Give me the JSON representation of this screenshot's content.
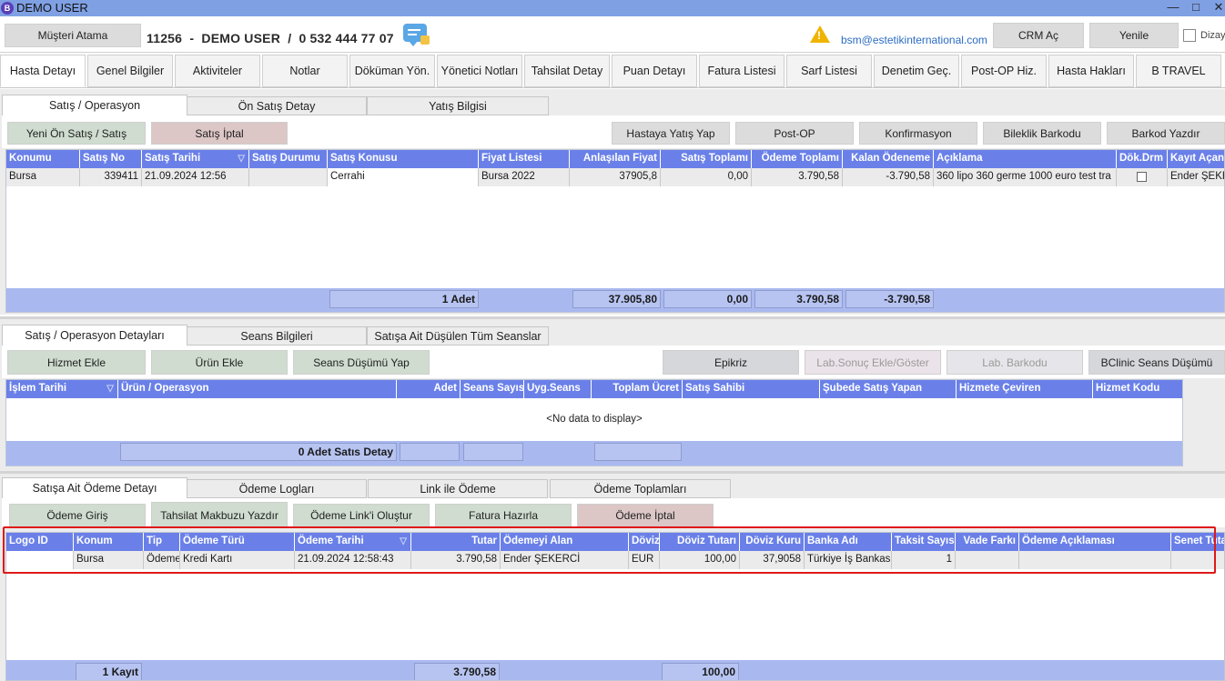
{
  "window": {
    "title": "DEMO USER",
    "app_icon": "B"
  },
  "topbar": {
    "assign_button": "Müşteri Atama",
    "patient_id": "11256",
    "sep1": "-",
    "patient_name": "DEMO USER",
    "sep2": "/",
    "patient_phone": "0 532 444 77 07",
    "email": "bsm@estetikinternational.com",
    "crm_button": "CRM Aç",
    "refresh_button": "Yenile",
    "edit_label": "Dizayn"
  },
  "main_tabs": [
    "Hasta Detayı",
    "Genel Bilgiler",
    "Aktiviteler",
    "Notlar",
    "Döküman Yön.",
    "Yönetici Notları",
    "Tahsilat Detay",
    "Puan Detayı",
    "Fatura Listesi",
    "Sarf Listesi",
    "Denetim Geç.",
    "Post-OP Hiz.",
    "Hasta Hakları",
    "B TRAVEL"
  ],
  "sales": {
    "tabs": [
      "Satış / Operasyon",
      "Ön Satış Detay",
      "Yatış Bilgisi"
    ],
    "buttons": {
      "pre_sale": "Yeni Ön Satış / Satış",
      "cancel": "Satış İptal",
      "admit": "Hastaya Yatış Yap",
      "post_op": "Post-OP",
      "confirm": "Konfirmasyon",
      "bracelet": "Bileklik Barkodu",
      "barcode": "Barkod Yazdır"
    },
    "columns": [
      "Konumu",
      "Satış No",
      "Satış Tarihi",
      "Satış Durumu",
      "Satış Konusu",
      "Fiyat Listesi",
      "Anlaşılan Fiyat",
      "Satış Toplamı",
      "Ödeme Toplamı",
      "Kalan Ödeneme",
      "Açıklama",
      "Dök.Drm",
      "Kayıt Açan"
    ],
    "rows": [
      [
        "Bursa",
        "339411",
        "21.09.2024 12:56",
        "",
        "Cerrahi",
        "Bursa 2022",
        "37905,8",
        "0,00",
        "3.790,58",
        "-3.790,58",
        "360 lipo 360 germe 1000 euro test tra",
        "",
        "Ender ŞEKERCİ"
      ]
    ],
    "footer": {
      "count": "1 Adet",
      "agreed": "37.905,80",
      "sales_total": "0,00",
      "paid": "3.790,58",
      "remaining": "-3.790,58"
    }
  },
  "details": {
    "tabs": [
      "Satış / Operasyon Detayları",
      "Seans Bilgileri",
      "Satışa Ait Düşülen Tüm Seanslar"
    ],
    "buttons": {
      "add_service": "Hizmet Ekle",
      "add_product": "Ürün Ekle",
      "session_deduct": "Seans Düşümü Yap",
      "epicrisis": "Epikriz",
      "lab_result": "Lab.Sonuç Ekle/Göster",
      "lab_barcode": "Lab. Barkodu",
      "bclinic": "BClinic Seans Düşümü"
    },
    "columns": [
      "İşlem Tarihi",
      "Ürün / Operasyon",
      "Adet",
      "Seans Sayısı",
      "Uyg.Seans",
      "Toplam Ücret",
      "Satış Sahibi",
      "Şubede Satış Yapan",
      "Hizmete Çeviren",
      "Hizmet Kodu"
    ],
    "empty_text": "<No data to display>",
    "footer": {
      "count": "0 Adet Satıs Detay"
    }
  },
  "payments": {
    "tabs": [
      "Satışa Ait Ödeme Detayı",
      "Ödeme Logları",
      "Link ile Ödeme",
      "Ödeme Toplamları"
    ],
    "buttons": {
      "entry": "Ödeme Giriş",
      "receipt": "Tahsilat Makbuzu Yazdır",
      "link": "Ödeme Link'i Oluştur",
      "invoice": "Fatura Hazırla",
      "cancel": "Ödeme İptal"
    },
    "columns": [
      "Logo ID",
      "Konum",
      "Tip",
      "Ödeme Türü",
      "Ödeme Tarihi",
      "Tutar",
      "Ödemeyi Alan",
      "Döviz",
      "Döviz Tutarı",
      "Döviz Kuru",
      "Banka Adı",
      "Taksit Sayısı",
      "Vade Farkı",
      "Ödeme Açıklaması",
      "Senet Tutarı"
    ],
    "rows": [
      [
        "",
        "Bursa",
        "Ödeme",
        "Kredi Kartı",
        "21.09.2024 12:58:43",
        "3.790,58",
        "Ender ŞEKERCİ",
        "EUR",
        "100,00",
        "37,9058",
        "Türkiye İş Bankası",
        "1",
        "",
        "",
        ""
      ]
    ],
    "footer": {
      "count": "1 Kayıt",
      "amount": "3.790,58",
      "fx_amount": "100,00"
    }
  },
  "colors": {
    "title_bar": "#7fa0e3",
    "grid_header": "#6a80e8",
    "footer": "#a9b9f0",
    "highlight": "#e01818"
  }
}
